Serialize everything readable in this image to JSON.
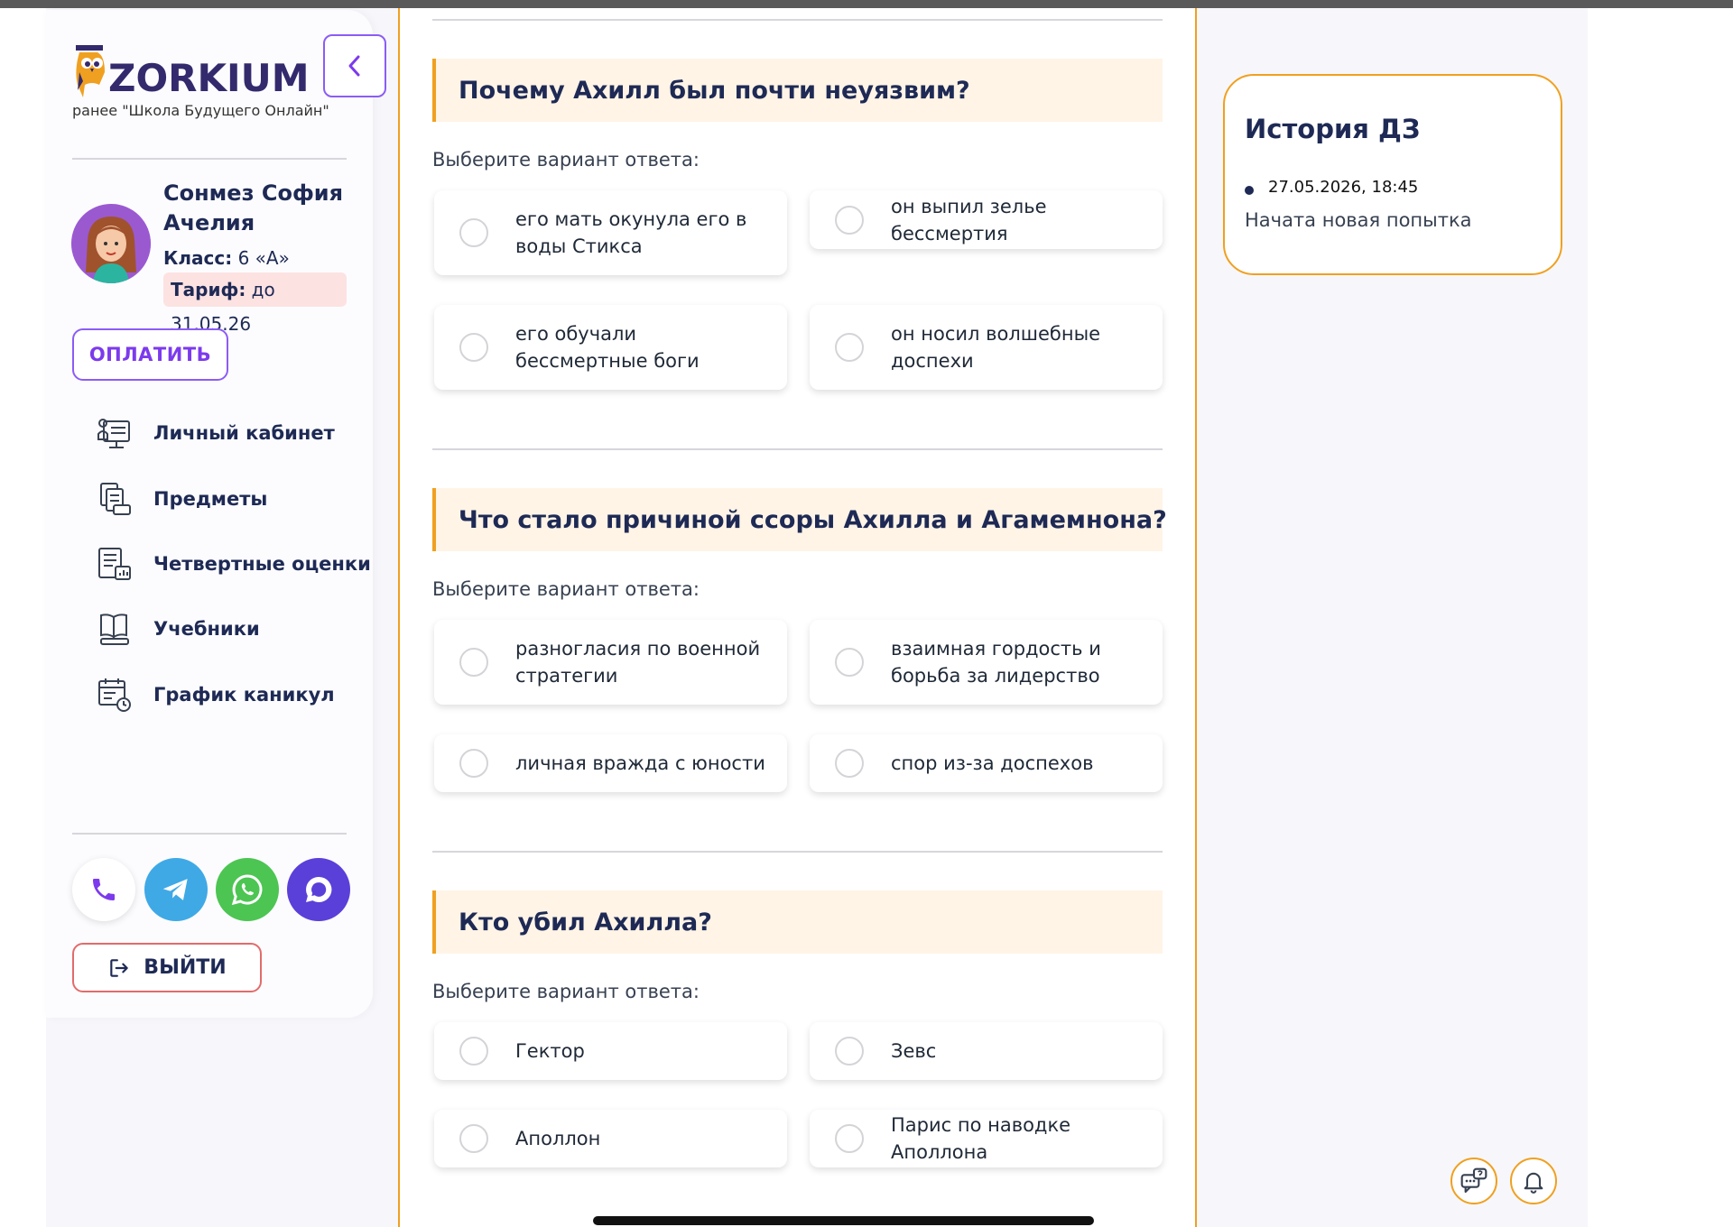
{
  "brand": {
    "logo_text": "ZORKIUM",
    "subtitle": "ранее \"Школа Будущего Онлайн\""
  },
  "user": {
    "name": "Сонмез София Ачелия",
    "class_label": "Класс:",
    "class_value": "6 «А»",
    "tariff_label": "Тариф:",
    "tariff_value": "до 31.05.26"
  },
  "sidebar": {
    "pay_label": "ОПЛАТИТЬ",
    "logout_label": "ВЫЙТИ",
    "items": [
      {
        "label": "Личный кабинет",
        "icon": "dashboard-icon"
      },
      {
        "label": "Предметы",
        "icon": "subjects-icon"
      },
      {
        "label": "Четвертные оценки",
        "icon": "grades-icon"
      },
      {
        "label": "Учебники",
        "icon": "book-icon"
      },
      {
        "label": "График каникул",
        "icon": "calendar-icon"
      }
    ],
    "contacts": [
      {
        "name": "phone",
        "icon": "phone-icon",
        "color": "#ffffff",
        "icon_color": "#7c3aed"
      },
      {
        "name": "telegram",
        "icon": "telegram-icon",
        "color": "#3fa9e6",
        "icon_color": "#ffffff"
      },
      {
        "name": "whatsapp",
        "icon": "whatsapp-icon",
        "color": "#4cc552",
        "icon_color": "#ffffff"
      },
      {
        "name": "chat",
        "icon": "chat-icon",
        "color": "#5b3fd9",
        "icon_color": "#ffffff"
      }
    ]
  },
  "questions": [
    {
      "title": "Почему Ахилл был почти неуязвим?",
      "hint": "Выберите вариант ответа:",
      "options": [
        "его мать окунула его в воды Стикса",
        "он выпил зелье бессмертия",
        "его обучали бессмертные боги",
        "он носил волшебные доспехи"
      ]
    },
    {
      "title": "Что стало причиной ссоры Ахилла и Агамемнона?",
      "hint": "Выберите вариант ответа:",
      "options": [
        "разногласия по военной стратегии",
        "взаимная гордость и борьба за лидерство",
        "личная вражда с юности",
        "спор из-за доспехов"
      ]
    },
    {
      "title": "Кто убил Ахилла?",
      "hint": "Выберите вариант ответа:",
      "options": [
        "Гектор",
        "Зевс",
        "Аполлон",
        "Парис по наводке Аполлона"
      ]
    }
  ],
  "history": {
    "title": "История ДЗ",
    "entries": [
      {
        "date": "27.05.2026, 18:45",
        "status": "Начата новая попытка"
      }
    ]
  },
  "colors": {
    "accent": "#f0a020",
    "brand": "#7c3aed",
    "text_dark": "#1e2a55",
    "question_bg": "#fff4e6"
  }
}
